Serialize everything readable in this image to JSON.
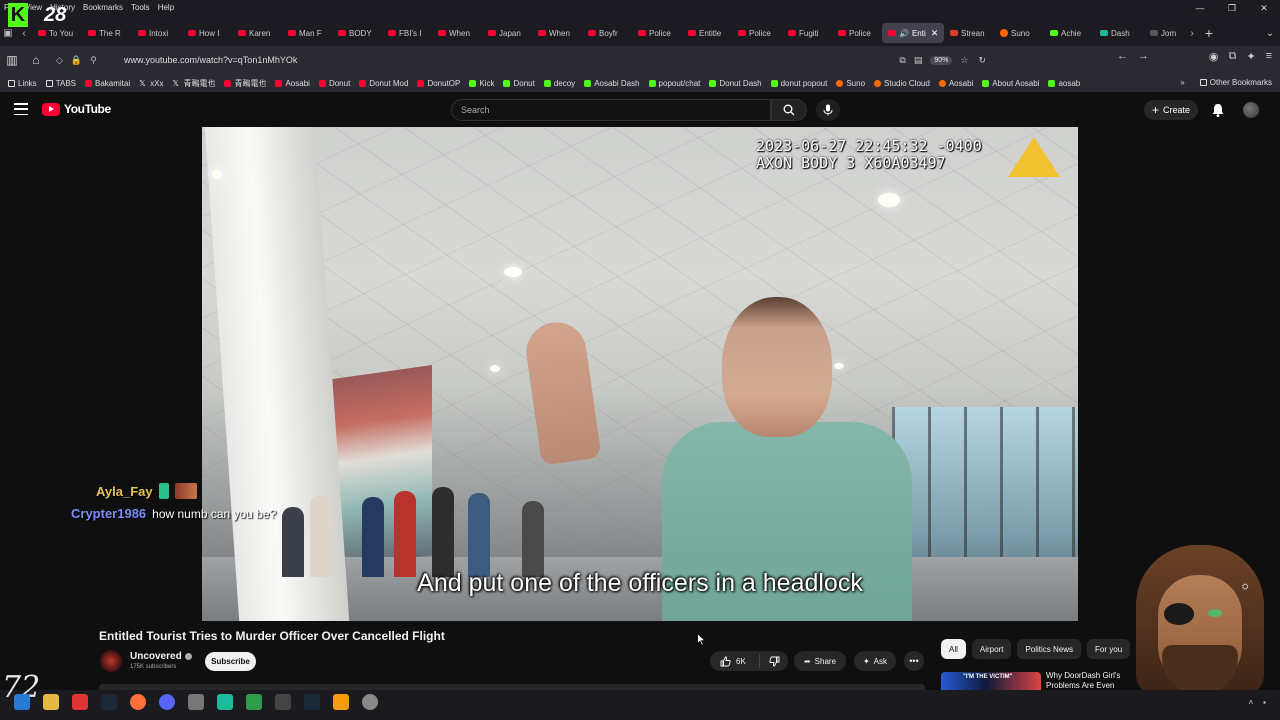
{
  "overlay": {
    "counter": "28"
  },
  "browser": {
    "menu": [
      "File",
      "View",
      "History",
      "Bookmarks",
      "Tools",
      "Help"
    ],
    "tabs": [
      {
        "label": "To You",
        "icon": "youtube-icon"
      },
      {
        "label": "The R",
        "icon": "youtube-icon"
      },
      {
        "label": "Intoxi",
        "icon": "youtube-icon"
      },
      {
        "label": "How I",
        "icon": "youtube-icon"
      },
      {
        "label": "Karen",
        "icon": "youtube-icon"
      },
      {
        "label": "Man F",
        "icon": "youtube-icon"
      },
      {
        "label": "BODY",
        "icon": "youtube-icon"
      },
      {
        "label": "FBI's I",
        "icon": "youtube-icon"
      },
      {
        "label": "When",
        "icon": "youtube-icon"
      },
      {
        "label": "Japan",
        "icon": "youtube-icon"
      },
      {
        "label": "When",
        "icon": "youtube-icon"
      },
      {
        "label": "Boyfr",
        "icon": "youtube-icon"
      },
      {
        "label": "Police",
        "icon": "youtube-icon"
      },
      {
        "label": "Entitle",
        "icon": "youtube-icon"
      },
      {
        "label": "Police",
        "icon": "youtube-icon"
      },
      {
        "label": "Fugiti",
        "icon": "youtube-icon"
      },
      {
        "label": "Police",
        "icon": "youtube-icon"
      },
      {
        "label": "Enti",
        "icon": "youtube-icon",
        "active": true
      },
      {
        "label": "Strean",
        "icon": "stream-icon"
      },
      {
        "label": "Suno",
        "icon": "suno-icon"
      },
      {
        "label": "Achie",
        "icon": "kick-icon"
      },
      {
        "label": "Dash",
        "icon": "dash-icon"
      },
      {
        "label": "Jom",
        "icon": "page-icon"
      }
    ],
    "url": "www.youtube.com/watch?v=qTon1nMhYOk",
    "zoom": "90%",
    "bookmarks": [
      {
        "label": "Links",
        "icon": "link-icon"
      },
      {
        "label": "TABS",
        "icon": "folder-icon"
      },
      {
        "label": "Bakamitai",
        "icon": "youtube-icon"
      },
      {
        "label": "xXx",
        "icon": "x-icon"
      },
      {
        "label": "青鵐電也",
        "icon": "x-icon"
      },
      {
        "label": "青鵐電也",
        "icon": "youtube-icon"
      },
      {
        "label": "Aosabi",
        "icon": "youtube-icon"
      },
      {
        "label": "Donut",
        "icon": "youtube-icon"
      },
      {
        "label": "Donut Mod",
        "icon": "youtube-icon"
      },
      {
        "label": "DonutOP",
        "icon": "youtube-icon"
      },
      {
        "label": "Kick",
        "icon": "kick-icon"
      },
      {
        "label": "Donut",
        "icon": "kick-icon"
      },
      {
        "label": "decoy",
        "icon": "kick-icon"
      },
      {
        "label": "Aosabi Dash",
        "icon": "kick-icon"
      },
      {
        "label": "popout/chat",
        "icon": "kick-icon"
      },
      {
        "label": "Donut Dash",
        "icon": "kick-icon"
      },
      {
        "label": "donut popout",
        "icon": "kick-icon"
      },
      {
        "label": "Suno",
        "icon": "suno-icon"
      },
      {
        "label": "Studio Cloud",
        "icon": "studio-icon"
      },
      {
        "label": "Aosabi",
        "icon": "studio-icon"
      },
      {
        "label": "About Aosabi",
        "icon": "kick-icon"
      },
      {
        "label": "aosab",
        "icon": "kick-icon"
      }
    ],
    "other_bookmarks": "Other Bookmarks"
  },
  "youtube": {
    "logo_text": "YouTube",
    "search_placeholder": "Search",
    "create_label": "Create",
    "video": {
      "timestamp_line1": "2023-06-27 22:45:32 -0400",
      "timestamp_line2": "AXON BODY 3 X60A03497",
      "subtitle": "And put one of the officers in a headlock"
    },
    "title": "Entitled Tourist Tries to Murder Officer Over Cancelled Flight",
    "channel": {
      "name": "Uncovered",
      "subscribers": "175K subscribers"
    },
    "subscribe_label": "Subscribe",
    "likes": "6K",
    "share_label": "Share",
    "ask_label": "Ask",
    "chips": [
      "All",
      "Airport",
      "Politics News",
      "For you"
    ],
    "recommendation": {
      "thumb_text": "\"I'M THE VICTIM\"",
      "title": "Why DoorDash Girl's Problems Are Even"
    }
  },
  "chat": [
    {
      "user": "Ayla_Fay",
      "message": ""
    },
    {
      "user": "Crypter1986",
      "message": "how numb can you be?"
    }
  ],
  "colors": {
    "youtube_red": "#ff0033",
    "kick_green": "#53fc18",
    "background": "#0f0f0f"
  }
}
